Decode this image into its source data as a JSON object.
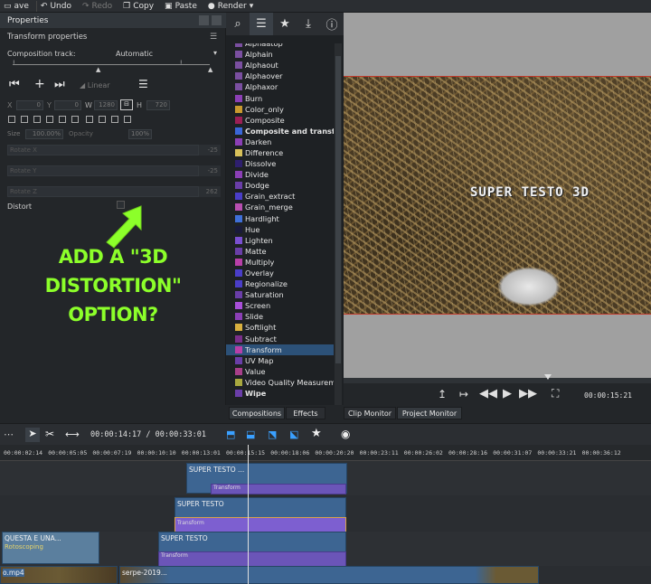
{
  "toolbar": {
    "items": [
      {
        "label": "ave",
        "icon": "save-icon",
        "dim": false
      },
      {
        "label": "Undo",
        "icon": "undo-icon",
        "dim": false
      },
      {
        "label": "Redo",
        "icon": "redo-icon",
        "dim": true
      },
      {
        "label": "Copy",
        "icon": "copy-icon",
        "dim": false
      },
      {
        "label": "Paste",
        "icon": "paste-icon",
        "dim": false
      },
      {
        "label": "Render",
        "icon": "render-icon",
        "dim": false
      }
    ]
  },
  "properties": {
    "title": "Properties",
    "subtitle": "Transform properties",
    "composition_label": "Composition track:",
    "composition_value": "Automatic",
    "interp_value": "Linear",
    "x_label": "X",
    "x_value": "0",
    "y_label": "Y",
    "y_value": "0",
    "w_label": "W",
    "w_value": "1280",
    "h_label": "H",
    "h_value": "720",
    "size_label": "Size",
    "size_value": "100.00%",
    "opacity_label": "Opacity",
    "opacity_value": "100%",
    "rotate_x_label": "Rotate X",
    "rotate_x_value": "-25",
    "rotate_y_label": "Rotate Y",
    "rotate_y_value": "-25",
    "rotate_z_label": "Rotate Z",
    "rotate_z_value": "262",
    "distort_label": "Distort"
  },
  "annotation": {
    "line1": "ADD A \"3D DISTORTION\"",
    "line2": "OPTION?"
  },
  "effects": {
    "items": [
      {
        "label": "Alphaatop",
        "color": "#7a4fa0"
      },
      {
        "label": "Alphain",
        "color": "#7a4fa0"
      },
      {
        "label": "Alphaout",
        "color": "#7a4fa0"
      },
      {
        "label": "Alphaover",
        "color": "#7a4fa0"
      },
      {
        "label": "Alphaxor",
        "color": "#7a4fa0"
      },
      {
        "label": "Burn",
        "color": "#8b3fb5"
      },
      {
        "label": "Color_only",
        "color": "#c99a2e"
      },
      {
        "label": "Composite",
        "color": "#9b1f55"
      },
      {
        "label": "Composite and transform",
        "color": "#3a66d8",
        "bold": true
      },
      {
        "label": "Darken",
        "color": "#8b3fb5"
      },
      {
        "label": "Difference",
        "color": "#d8c15a"
      },
      {
        "label": "Dissolve",
        "color": "#2e1f6e"
      },
      {
        "label": "Divide",
        "color": "#8b3fb5"
      },
      {
        "label": "Dodge",
        "color": "#6a3ea8"
      },
      {
        "label": "Grain_extract",
        "color": "#4a3ec8"
      },
      {
        "label": "Grain_merge",
        "color": "#b84fb0"
      },
      {
        "label": "Hardlight",
        "color": "#3f6fd8"
      },
      {
        "label": "Hue",
        "color": "#1a1a3a"
      },
      {
        "label": "Lighten",
        "color": "#7a4fd0"
      },
      {
        "label": "Matte",
        "color": "#6a3ea8"
      },
      {
        "label": "Multiply",
        "color": "#b83fa8"
      },
      {
        "label": "Overlay",
        "color": "#4a3ec8"
      },
      {
        "label": "Regionalize",
        "color": "#4a3ec8"
      },
      {
        "label": "Saturation",
        "color": "#6a3ea8"
      },
      {
        "label": "Screen",
        "color": "#a84fd8"
      },
      {
        "label": "Slide",
        "color": "#8b3fb5"
      },
      {
        "label": "Softlight",
        "color": "#d8b03f"
      },
      {
        "label": "Subtract",
        "color": "#7a2f8a"
      },
      {
        "label": "Transform",
        "color": "#b83fa8",
        "selected": true
      },
      {
        "label": "UV Map",
        "color": "#6a3ea8"
      },
      {
        "label": "Value",
        "color": "#a83f8a"
      },
      {
        "label": "Video Quality Measurement",
        "color": "#a8a83f"
      },
      {
        "label": "Wipe",
        "color": "#6a3ea8",
        "bold": true
      }
    ],
    "tabs": {
      "compositions": "Compositions",
      "effects": "Effects",
      "clip_monitor": "Clip Monitor",
      "project_monitor": "Project Monitor"
    }
  },
  "monitor": {
    "overlay_text": "SUPER TESTO 3D",
    "timecode": "00:00:15:21"
  },
  "timeline": {
    "position": "00:00:14:17",
    "duration": "00:00:33:01",
    "ticks": [
      "00:00:02:14",
      "00:00:05:05",
      "00:00:07:19",
      "00:00:10:10",
      "00:00:13:01",
      "00:00:15:15",
      "00:00:18:06",
      "00:00:20:20",
      "00:00:23:11",
      "00:00:26:02",
      "00:00:28:16",
      "00:00:31:07",
      "00:00:33:21",
      "00:00:36:12"
    ],
    "clips": {
      "c1": "SUPER TESTO ...",
      "c2": "SUPER TESTO",
      "c3": "QUESTA E UNA...",
      "c3_fx": "Rotoscoping",
      "c4": "SUPER TESTO",
      "c5": "o.mp4",
      "c6": "serpe-2019...",
      "fx1": "Transform",
      "fx2": "Transform",
      "fx3": "Transform"
    }
  }
}
